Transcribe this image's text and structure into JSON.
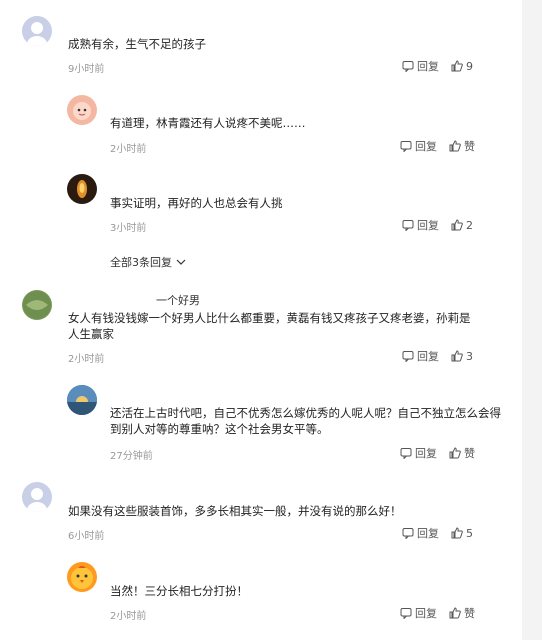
{
  "comments": [
    {
      "user": "",
      "text": "成熟有余，生气不足的孩子",
      "time": "9小时前",
      "reply": "回复",
      "likes": "9"
    },
    {
      "user": "",
      "text": "有道理，林青霞还有人说疼不美呢……",
      "time": "2小时前",
      "reply": "回复",
      "likes": "赞"
    },
    {
      "user": "",
      "text": "事实证明，再好的人也总会有人挑",
      "time": "3小时前",
      "reply": "回复",
      "likes": "2"
    },
    {
      "more": "全部3条回复"
    },
    {
      "user": "一个好男",
      "text": "女人有钱没钱嫁一个好男人比什么都重要，黄磊有钱又疼孩子又疼老婆，孙莉是人生赢家",
      "time": "2小时前",
      "reply": "回复",
      "likes": "3"
    },
    {
      "user": "",
      "text": "还活在上古时代吧，自己不优秀怎么嫁优秀的人呢人呢？自己不独立怎么会得到别人对等的尊重呐？这个社会男女平等。",
      "time": "27分钟前",
      "reply": "回复",
      "likes": "赞"
    },
    {
      "user": "",
      "text": "如果没有这些服装首饰，多多长相其实一般，并没有说的那么好！",
      "time": "6小时前",
      "reply": "回复",
      "likes": "5"
    },
    {
      "user": "",
      "text": "当然！三分长相七分打扮！",
      "time": "2小时前",
      "reply": "回复",
      "likes": "赞"
    }
  ]
}
